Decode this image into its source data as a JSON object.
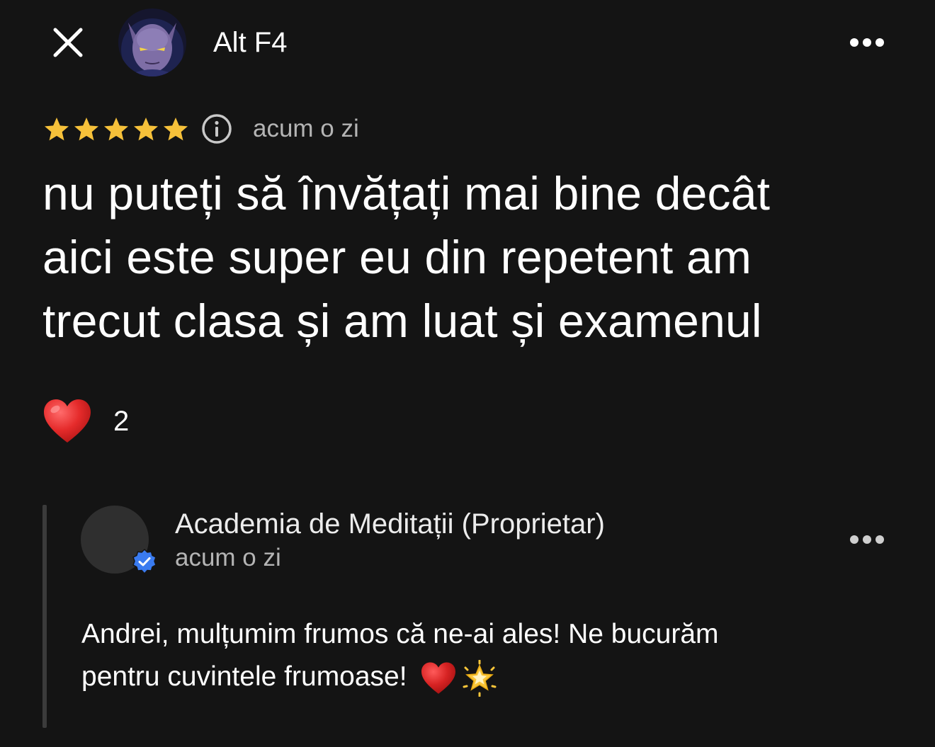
{
  "review": {
    "author_name": "Alt F4",
    "rating": 5,
    "rating_max": 5,
    "time": "acum o zi",
    "text_lines": [
      "nu puteți să învățați mai bine decât",
      "aici este super eu din repetent am",
      "trecut clasa și am luat și examenul"
    ],
    "reaction": {
      "icon": "heart-icon",
      "count": "2"
    }
  },
  "reply": {
    "author_name": "Academia de Meditații (Proprietar)",
    "time": "acum o zi",
    "text_lines": [
      "Andrei, mulțumim frumos că ne-ai ales! Ne bucurăm",
      "pentru cuvintele frumoase!"
    ],
    "trailing_icons": [
      "heart-icon",
      "glowing-star-icon"
    ]
  },
  "icons": {
    "close": "close-icon",
    "more": "more-options-icon",
    "info": "info-icon",
    "verified": "verified-badge-icon"
  },
  "colors": {
    "background": "#141414",
    "star": "#f6c13a",
    "heart": "#e02b2b",
    "verified": "#3a7bf0",
    "muted_text": "#b4b4b4"
  }
}
